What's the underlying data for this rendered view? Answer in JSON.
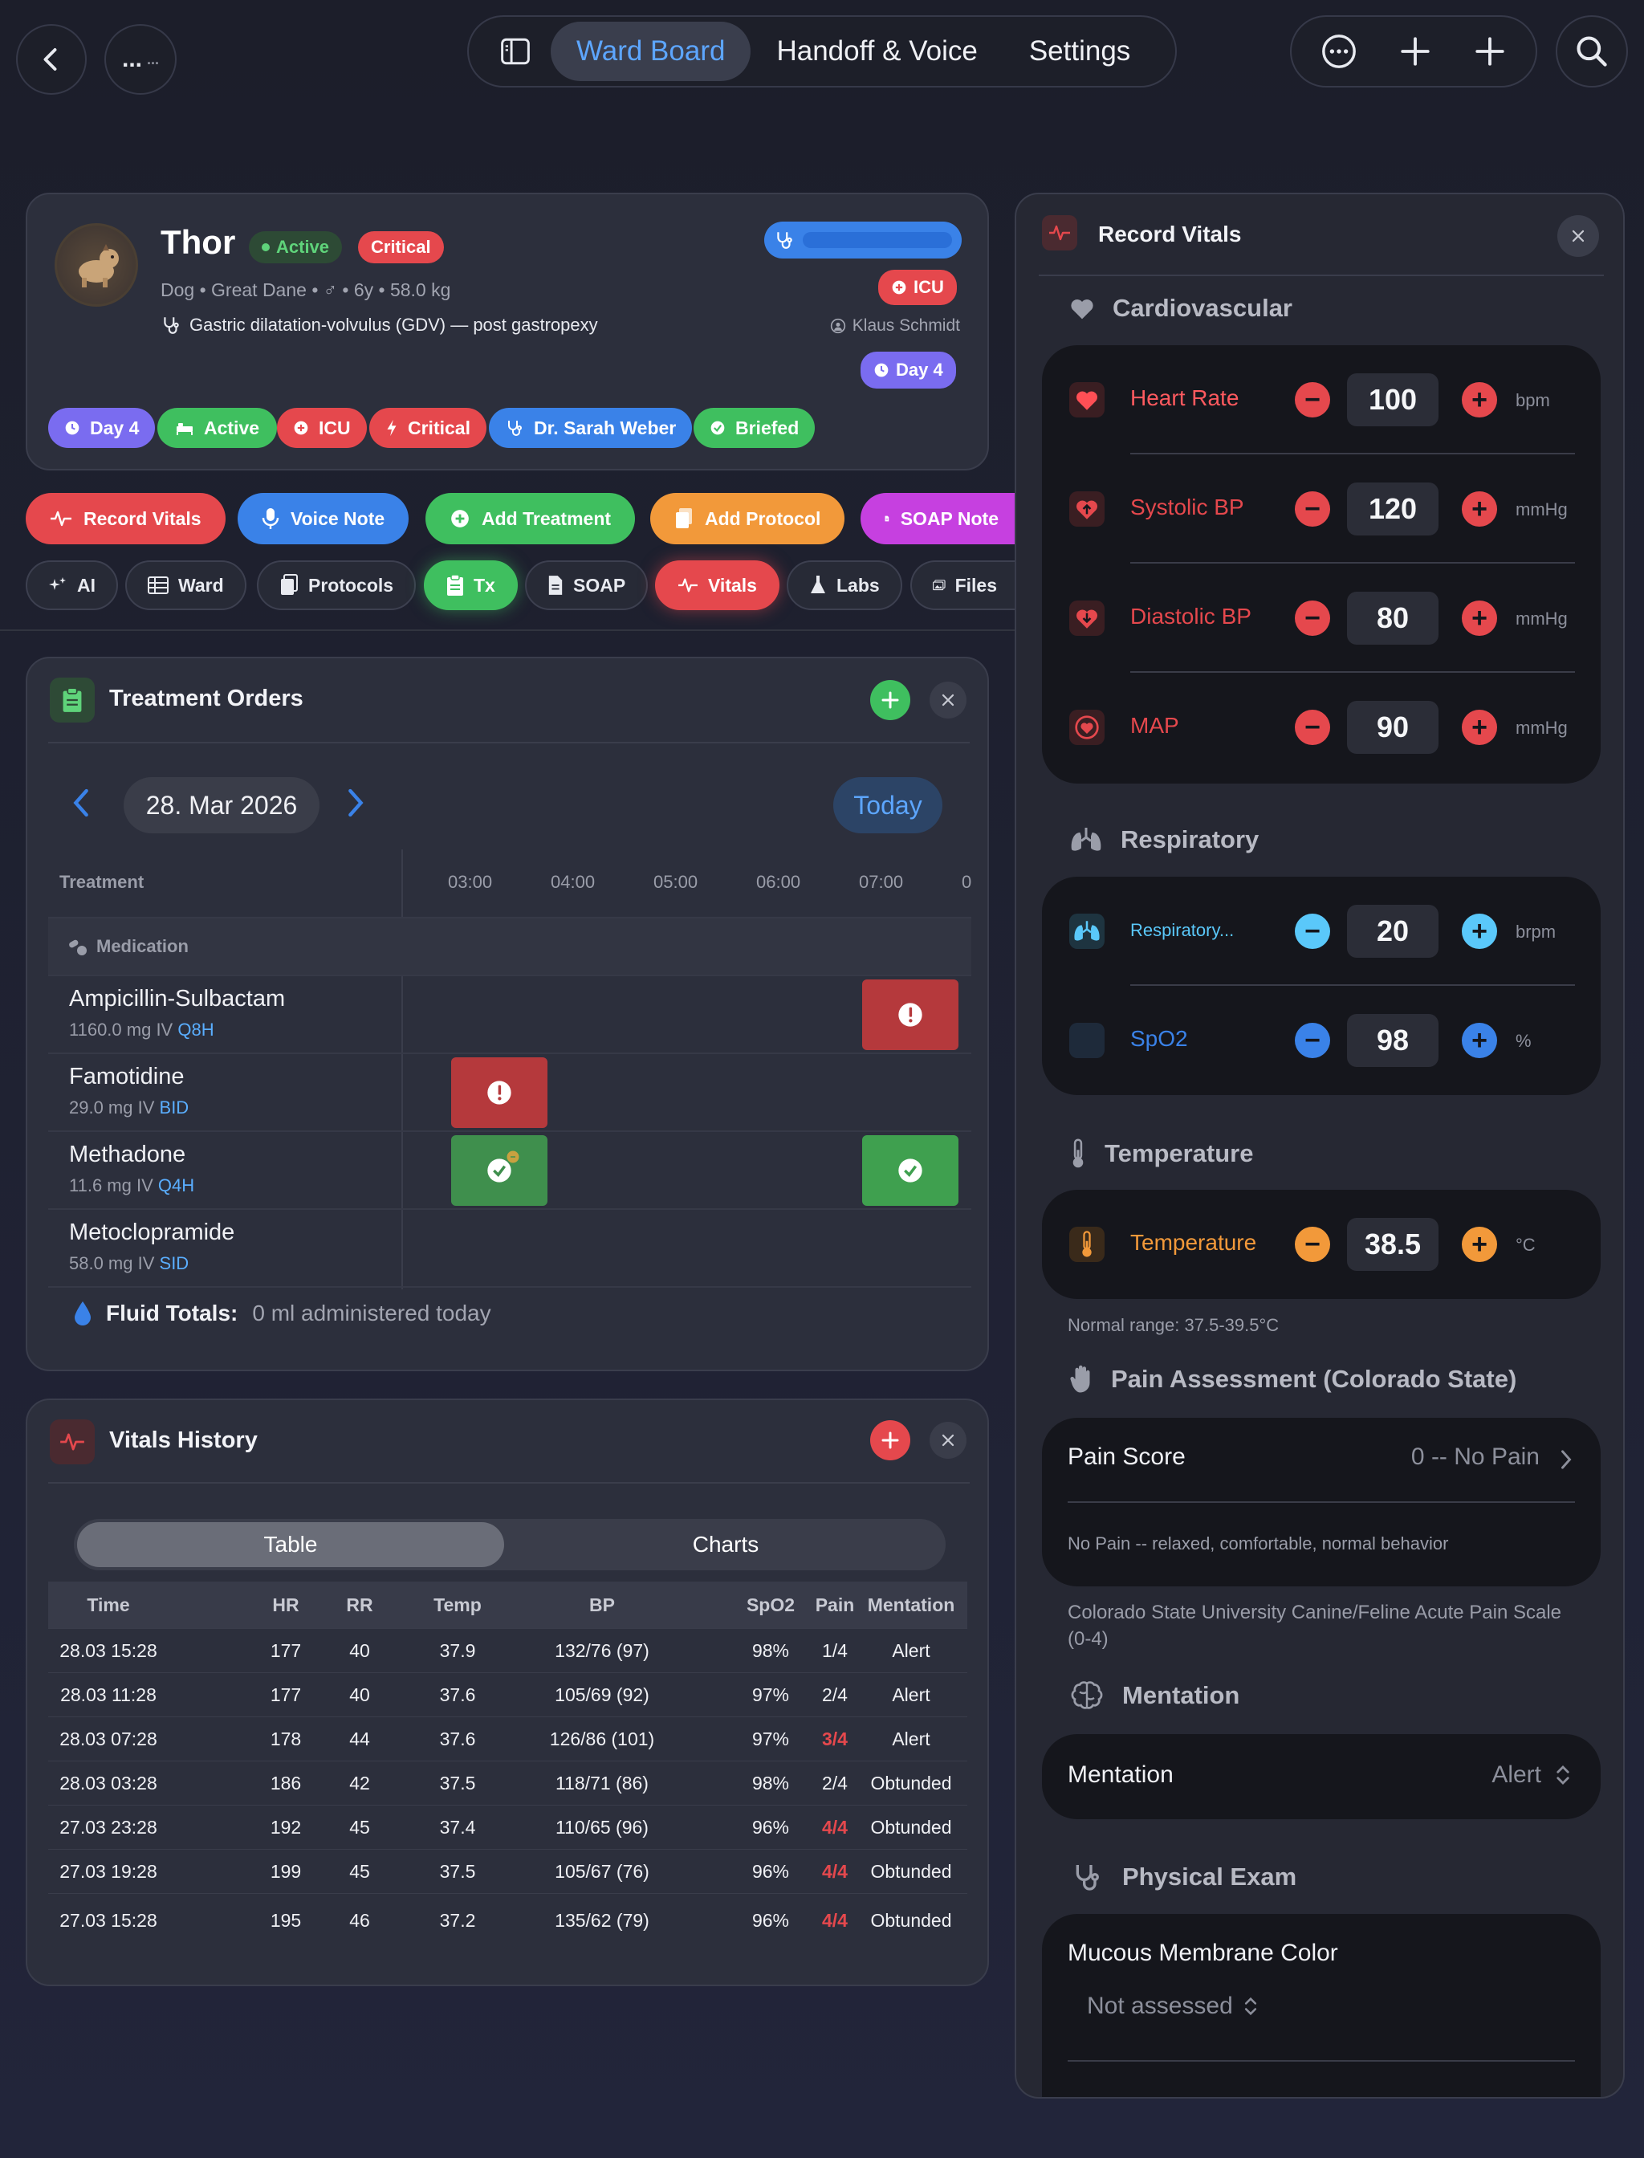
{
  "topbar": {
    "back_icon": "chevron-left-icon",
    "more_label": "...",
    "more_sub": "...",
    "tabs": [
      "Ward Board",
      "Handoff & Voice",
      "Settings"
    ],
    "active_tab": "Ward Board"
  },
  "patient": {
    "name": "Thor",
    "status_badge": "Active",
    "severity_badge": "Critical",
    "details": "Dog • Great Dane • ♂ • 6y • 58.0 kg",
    "diagnosis": "Gastric dilatation-volvulus (GDV) — post gastropexy",
    "location_badge": "ICU",
    "owner": "Klaus Schmidt",
    "day_badge": "Day 4",
    "chips": [
      "Day 4",
      "Active",
      "ICU",
      "Critical",
      "Dr. Sarah Weber",
      "Briefed"
    ]
  },
  "actions": [
    "Record Vitals",
    "Voice Note",
    "Add Treatment",
    "Add Protocol",
    "SOAP Note"
  ],
  "tabs": [
    "AI",
    "Ward",
    "Protocols",
    "Tx",
    "SOAP",
    "Vitals",
    "Labs",
    "Files"
  ],
  "treatment": {
    "title": "Treatment Orders",
    "date": "28. Mar 2026",
    "today": "Today",
    "column_header": "Treatment",
    "hours": [
      "03:00",
      "04:00",
      "05:00",
      "06:00",
      "07:00",
      "0"
    ],
    "group": "Medication",
    "rows": [
      {
        "name": "Ampicillin-Sulbactam",
        "dose": "1160.0 mg  IV",
        "freq": "Q8H"
      },
      {
        "name": "Famotidine",
        "dose": "29.0 mg  IV",
        "freq": "BID"
      },
      {
        "name": "Methadone",
        "dose": "11.6 mg  IV",
        "freq": "Q4H"
      },
      {
        "name": "Metoclopramide",
        "dose": "58.0 mg  IV",
        "freq": "SID"
      }
    ],
    "fluid_label": "Fluid Totals:",
    "fluid_value": "0 ml administered today"
  },
  "vitals_history": {
    "title": "Vitals History",
    "segments": [
      "Table",
      "Charts"
    ],
    "columns": [
      "Time",
      "HR",
      "RR",
      "Temp",
      "BP",
      "SpO2",
      "Pain",
      "Mentation"
    ],
    "rows": [
      [
        "28.03 15:28",
        "177",
        "40",
        "37.9",
        "132/76 (97)",
        "98%",
        "1/4",
        "Alert"
      ],
      [
        "28.03 11:28",
        "177",
        "40",
        "37.6",
        "105/69 (92)",
        "97%",
        "2/4",
        "Alert"
      ],
      [
        "28.03 07:28",
        "178",
        "44",
        "37.6",
        "126/86 (101)",
        "97%",
        "3/4",
        "Alert"
      ],
      [
        "28.03 03:28",
        "186",
        "42",
        "37.5",
        "118/71 (86)",
        "98%",
        "2/4",
        "Obtunded"
      ],
      [
        "27.03 23:28",
        "192",
        "45",
        "37.4",
        "110/65 (96)",
        "96%",
        "4/4",
        "Obtunded"
      ],
      [
        "27.03 19:28",
        "199",
        "45",
        "37.5",
        "105/67 (76)",
        "96%",
        "4/4",
        "Obtunded"
      ],
      [
        "27.03 15:28",
        "195",
        "46",
        "37.2",
        "135/62 (79)",
        "96%",
        "4/4",
        "Obtunded"
      ]
    ]
  },
  "record_vitals": {
    "title": "Record Vitals",
    "cardio_title": "Cardiovascular",
    "cardio": [
      {
        "label": "Heart Rate",
        "value": "100",
        "unit": "bpm"
      },
      {
        "label": "Systolic BP",
        "value": "120",
        "unit": "mmHg"
      },
      {
        "label": "Diastolic BP",
        "value": "80",
        "unit": "mmHg"
      },
      {
        "label": "MAP",
        "value": "90",
        "unit": "mmHg"
      }
    ],
    "resp_title": "Respiratory",
    "resp": [
      {
        "label": "Respiratory...",
        "value": "20",
        "unit": "brpm"
      },
      {
        "label": "SpO2",
        "value": "98",
        "unit": "%"
      }
    ],
    "temp_title": "Temperature",
    "temp": {
      "label": "Temperature",
      "value": "38.5",
      "unit": "°C"
    },
    "temp_note": "Normal range: 37.5-39.5°C",
    "pain_title": "Pain Assessment (Colorado State)",
    "pain_label": "Pain Score",
    "pain_value": "0 -- No Pain",
    "pain_desc": "No Pain -- relaxed, comfortable, normal behavior",
    "pain_note": "Colorado State University Canine/Feline Acute Pain Scale (0-4)",
    "mentation_title": "Mentation",
    "mentation_label": "Mentation",
    "mentation_value": "Alert",
    "exam_title": "Physical Exam",
    "mm_label": "Mucous Membrane Color",
    "mm_value": "Not assessed"
  },
  "colors": {
    "accent": "#5da6ff",
    "critical": "#e5484d",
    "success": "#3fbf5f",
    "warning": "#f2993a",
    "purple": "#7a6cf0"
  }
}
